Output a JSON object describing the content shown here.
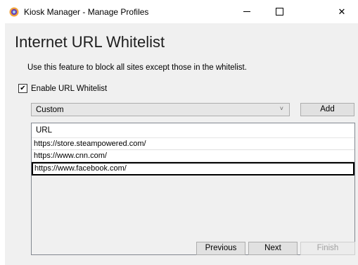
{
  "window": {
    "title": "Kiosk Manager - Manage Profiles",
    "close_glyph": "✕",
    "icon": "app-globe-icon"
  },
  "page": {
    "heading": "Internet URL Whitelist",
    "description": "Use this feature to block all sites except those in the whitelist."
  },
  "whitelist": {
    "enable_label": "Enable URL Whitelist",
    "enabled": true,
    "check_glyph": "✔",
    "category_selected": "Custom",
    "dropdown_glyph": "˅",
    "add_label": "Add",
    "column_header": "URL",
    "urls": [
      "https://store.steampowered.com/",
      "https://www.cnn.com/",
      "https://www.facebook.com/"
    ]
  },
  "nav": {
    "previous_label": "Previous",
    "next_label": "Next",
    "finish_label": "Finish"
  }
}
